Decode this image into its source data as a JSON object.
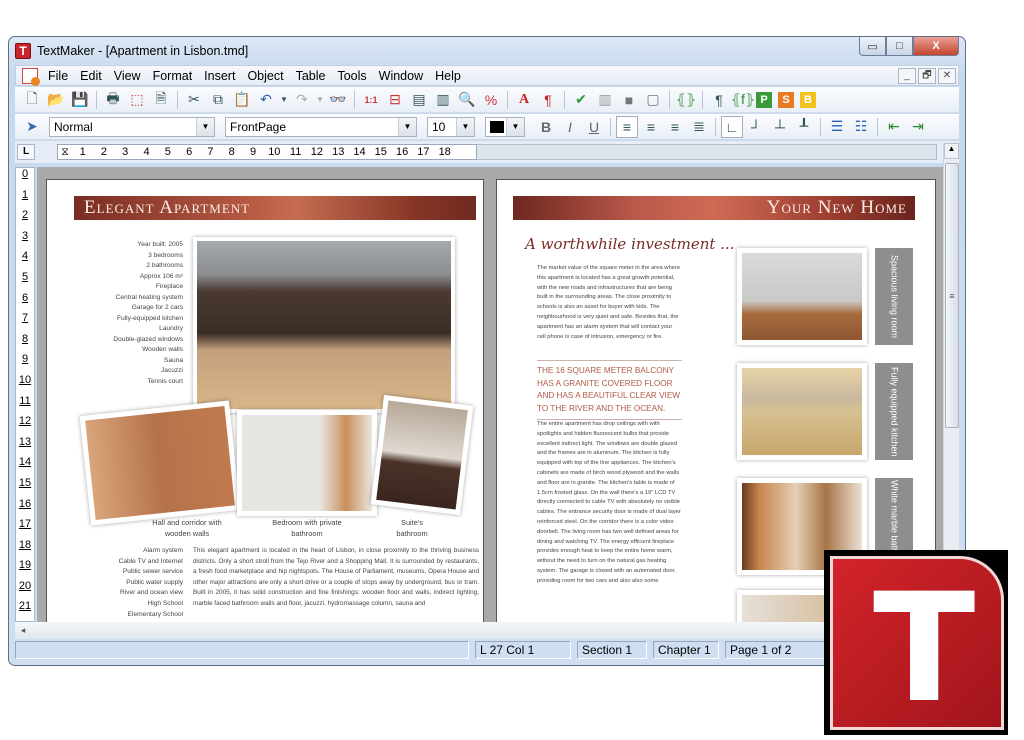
{
  "window": {
    "title": "TextMaker - [Apartment in Lisbon.tmd]",
    "app_icon_letter": "T",
    "controls": {
      "minimize": "▭",
      "maximize": "□",
      "close": "X"
    }
  },
  "menubar": {
    "items": [
      "File",
      "Edit",
      "View",
      "Format",
      "Insert",
      "Object",
      "Table",
      "Tools",
      "Window",
      "Help"
    ],
    "doc_controls": [
      "_",
      "🗗",
      "✕"
    ]
  },
  "toolbar_standard": {
    "icons": [
      "new-document",
      "open-folder",
      "save",
      "print",
      "export-pdf",
      "print-preview",
      "cut",
      "copy",
      "paste",
      "undo",
      "redo",
      "find",
      "zoom-100",
      "page-width",
      "full-page",
      "two-pages",
      "zoom",
      "zoom-percent",
      "character-format",
      "paragraph-format",
      "spell-check",
      "chart",
      "shading",
      "frame",
      "field",
      "formatting-marks",
      "field-shading",
      "presentations",
      "planmaker",
      "basicmaker"
    ]
  },
  "toolbar_format": {
    "style": "Normal",
    "font": "FrontPage",
    "size": "10",
    "color": "#000000",
    "buttons": [
      "Bold",
      "Italic",
      "Underline",
      "Align left",
      "Align right",
      "Center",
      "Justify",
      "Left tab",
      "Right tab",
      "Center tab",
      "Decimal tab",
      "Bullets",
      "Numbering",
      "Decrease indent",
      "Increase indent"
    ]
  },
  "ruler": {
    "horizontal": [
      "1",
      "2",
      "3",
      "4",
      "5",
      "6",
      "7",
      "8",
      "9",
      "10",
      "11",
      "12",
      "13",
      "14",
      "15",
      "16",
      "17",
      "18"
    ],
    "vertical": [
      "0",
      "1",
      "2",
      "3",
      "4",
      "5",
      "6",
      "7",
      "8",
      "9",
      "10",
      "11",
      "12",
      "13",
      "14",
      "15",
      "16",
      "17",
      "18",
      "19",
      "20",
      "21"
    ],
    "tab_stop_symbol": "L"
  },
  "page_left": {
    "banner": "Elegant Apartment",
    "features": [
      "Year built: 2005",
      "3 bedrooms",
      "2 bathrooms",
      "Approx 106 m²",
      "Fireplace",
      "Central heating system",
      "Garage for 2 cars",
      "Fully-equipped kitchen",
      "Laundry",
      "Double-glazed windows",
      "Wooden walls",
      "Sauna",
      "Jacuzzi",
      "Tennis court"
    ],
    "captions": [
      "Hall and corridor with wooden walls",
      "Bedroom with private bathroom",
      "Suite's bathroom"
    ],
    "features2": [
      "Alarm system",
      "Cable TV and Internet",
      "Public sewer service",
      "Public water supply",
      "River and ocean view",
      "High School",
      "Elementary School"
    ],
    "body": "This elegant apartment is located in the heart of Lisbon, in close proximity to the thriving business districts. Only a short stroll from the Tejo River and a Shopping Mall. It is surrounded by restaurants, a fresh food marketplace and hip nightspots. The House of Parliament, museums, Opera House and other major attractions are only a short drive or a couple of stops away by underground, bus or tram. Built in 2005, it has solid construction and fine finishings: wooden floor and walls, indirect lighting, marble faced bathroom walls and floor, jacuzzi, hydromassage column, sauna and"
  },
  "page_right": {
    "banner": "Your New Home",
    "heading": "A worthwhile investment ...",
    "para1": "The market value of the square meter in the area where this apartment is located has a great growth potential, with the new roads and infrastructures that are being built in the surrounding areas. The close proximity to schools is also an asset for buyer with kids. The neighbourhood is very quiet and safe. Besides that, the apartment has an alarm system that will contact your cell phone is case of intrusion, emergency or fire.",
    "quote": "THE 16 SQUARE METER BALCONY HAS A GRANITE COVERED FLOOR AND HAS A BEAUTIFUL CLEAR VIEW TO THE RIVER AND THE OCEAN.",
    "para2": "The entire apartment has drop ceilings with with spotlights and hidden fluorescent bulbs that provide excellent indirect light. The windows are double glazed and the frames are in aluminum. The kitchen is fully equipped with top of the line appliances. The kitchen's cabinets are made of birch wood plywood and the walls and floor are in granite. The kitchen's table is made of 1.5cm frosted glass. On the wall there's a 19\" LCD TV directly connected to cable TV with absolutely no visible cables. The entrance security door is made of dual layer reinforced steel. On the corridor there is a color video doorbell. The living room has two well defined areas for dining and watching TV. The energy efficient fireplace provides enough heat to keep the entire home warm, without the need to turn on the natural gas heating system. The garage is closed with an automated door, providing room for two cars and also also some",
    "gallery_tags": [
      "Spacious living room",
      "Fully equipped kitchen",
      "White marble bathroom"
    ]
  },
  "statusbar": {
    "position": "L 27 Col 1",
    "section": "Section 1",
    "chapter": "Chapter 1",
    "page": "Page 1 of 2"
  },
  "logo": {
    "letter": "T"
  }
}
